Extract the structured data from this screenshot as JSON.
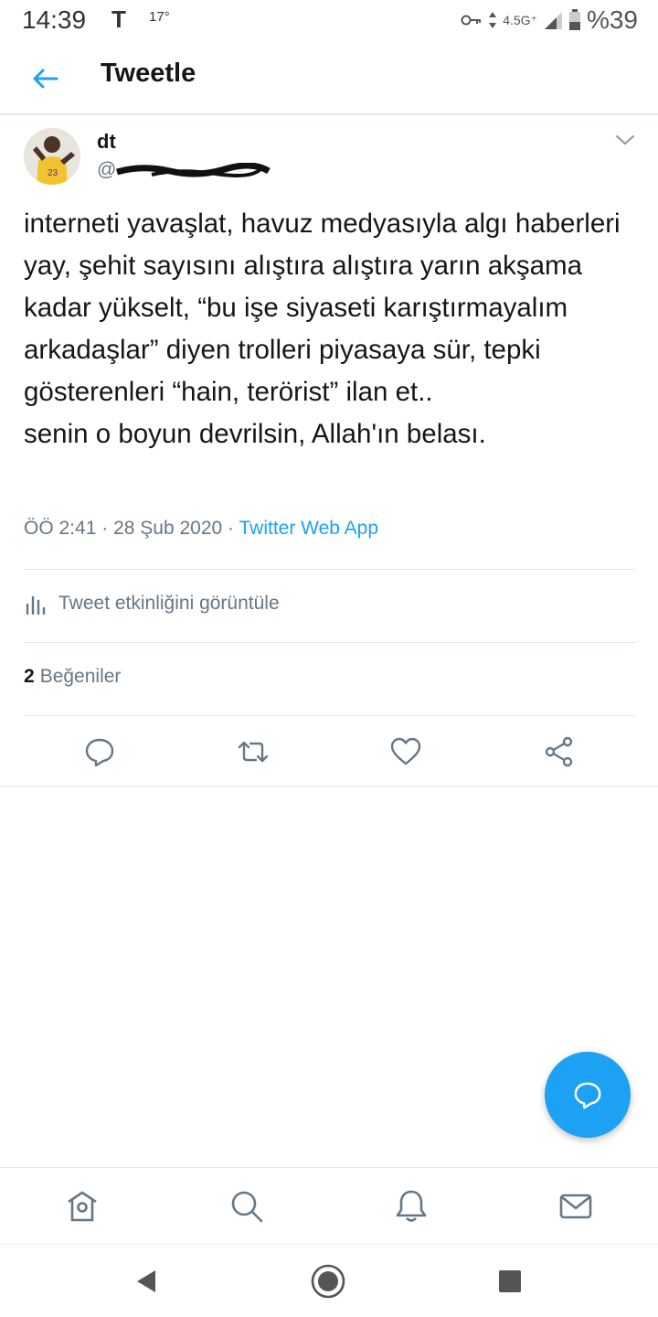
{
  "status_bar": {
    "time": "14:39",
    "carrier_icon": "T",
    "temperature": "17°",
    "network": "4.5G⁺",
    "battery": "%39"
  },
  "header": {
    "back_icon": "arrow-left-icon",
    "title": "Tweetle"
  },
  "tweet": {
    "author_name": "dt",
    "author_handle": "@",
    "text": "interneti yavaşlat, havuz medyasıyla algı haberleri yay, şehit sayısını alıştıra alıştıra yarın akşama kadar yükselt, “bu işe siyaseti karıştırmayalım arkadaşlar” diyen trolleri piyasaya sür, tepki gösterenleri “hain, terörist” ilan et..\nsenin o boyun devrilsin, Allah'ın belası.",
    "time": "ÖÖ 2:41",
    "separator": "·",
    "date": "28 Şub 2020",
    "source": "Twitter Web App",
    "activity_label": "Tweet etkinliğini görüntüle",
    "likes_count": "2",
    "likes_label": "Beğeniler"
  },
  "actions": [
    "reply-icon",
    "retweet-icon",
    "like-icon",
    "share-icon"
  ],
  "bottom_nav": [
    "home-icon",
    "search-icon",
    "notifications-icon",
    "messages-icon"
  ],
  "colors": {
    "accent": "#1da1f2",
    "text": "#14171a",
    "secondary": "#657786",
    "divider": "#e1e8ed"
  }
}
